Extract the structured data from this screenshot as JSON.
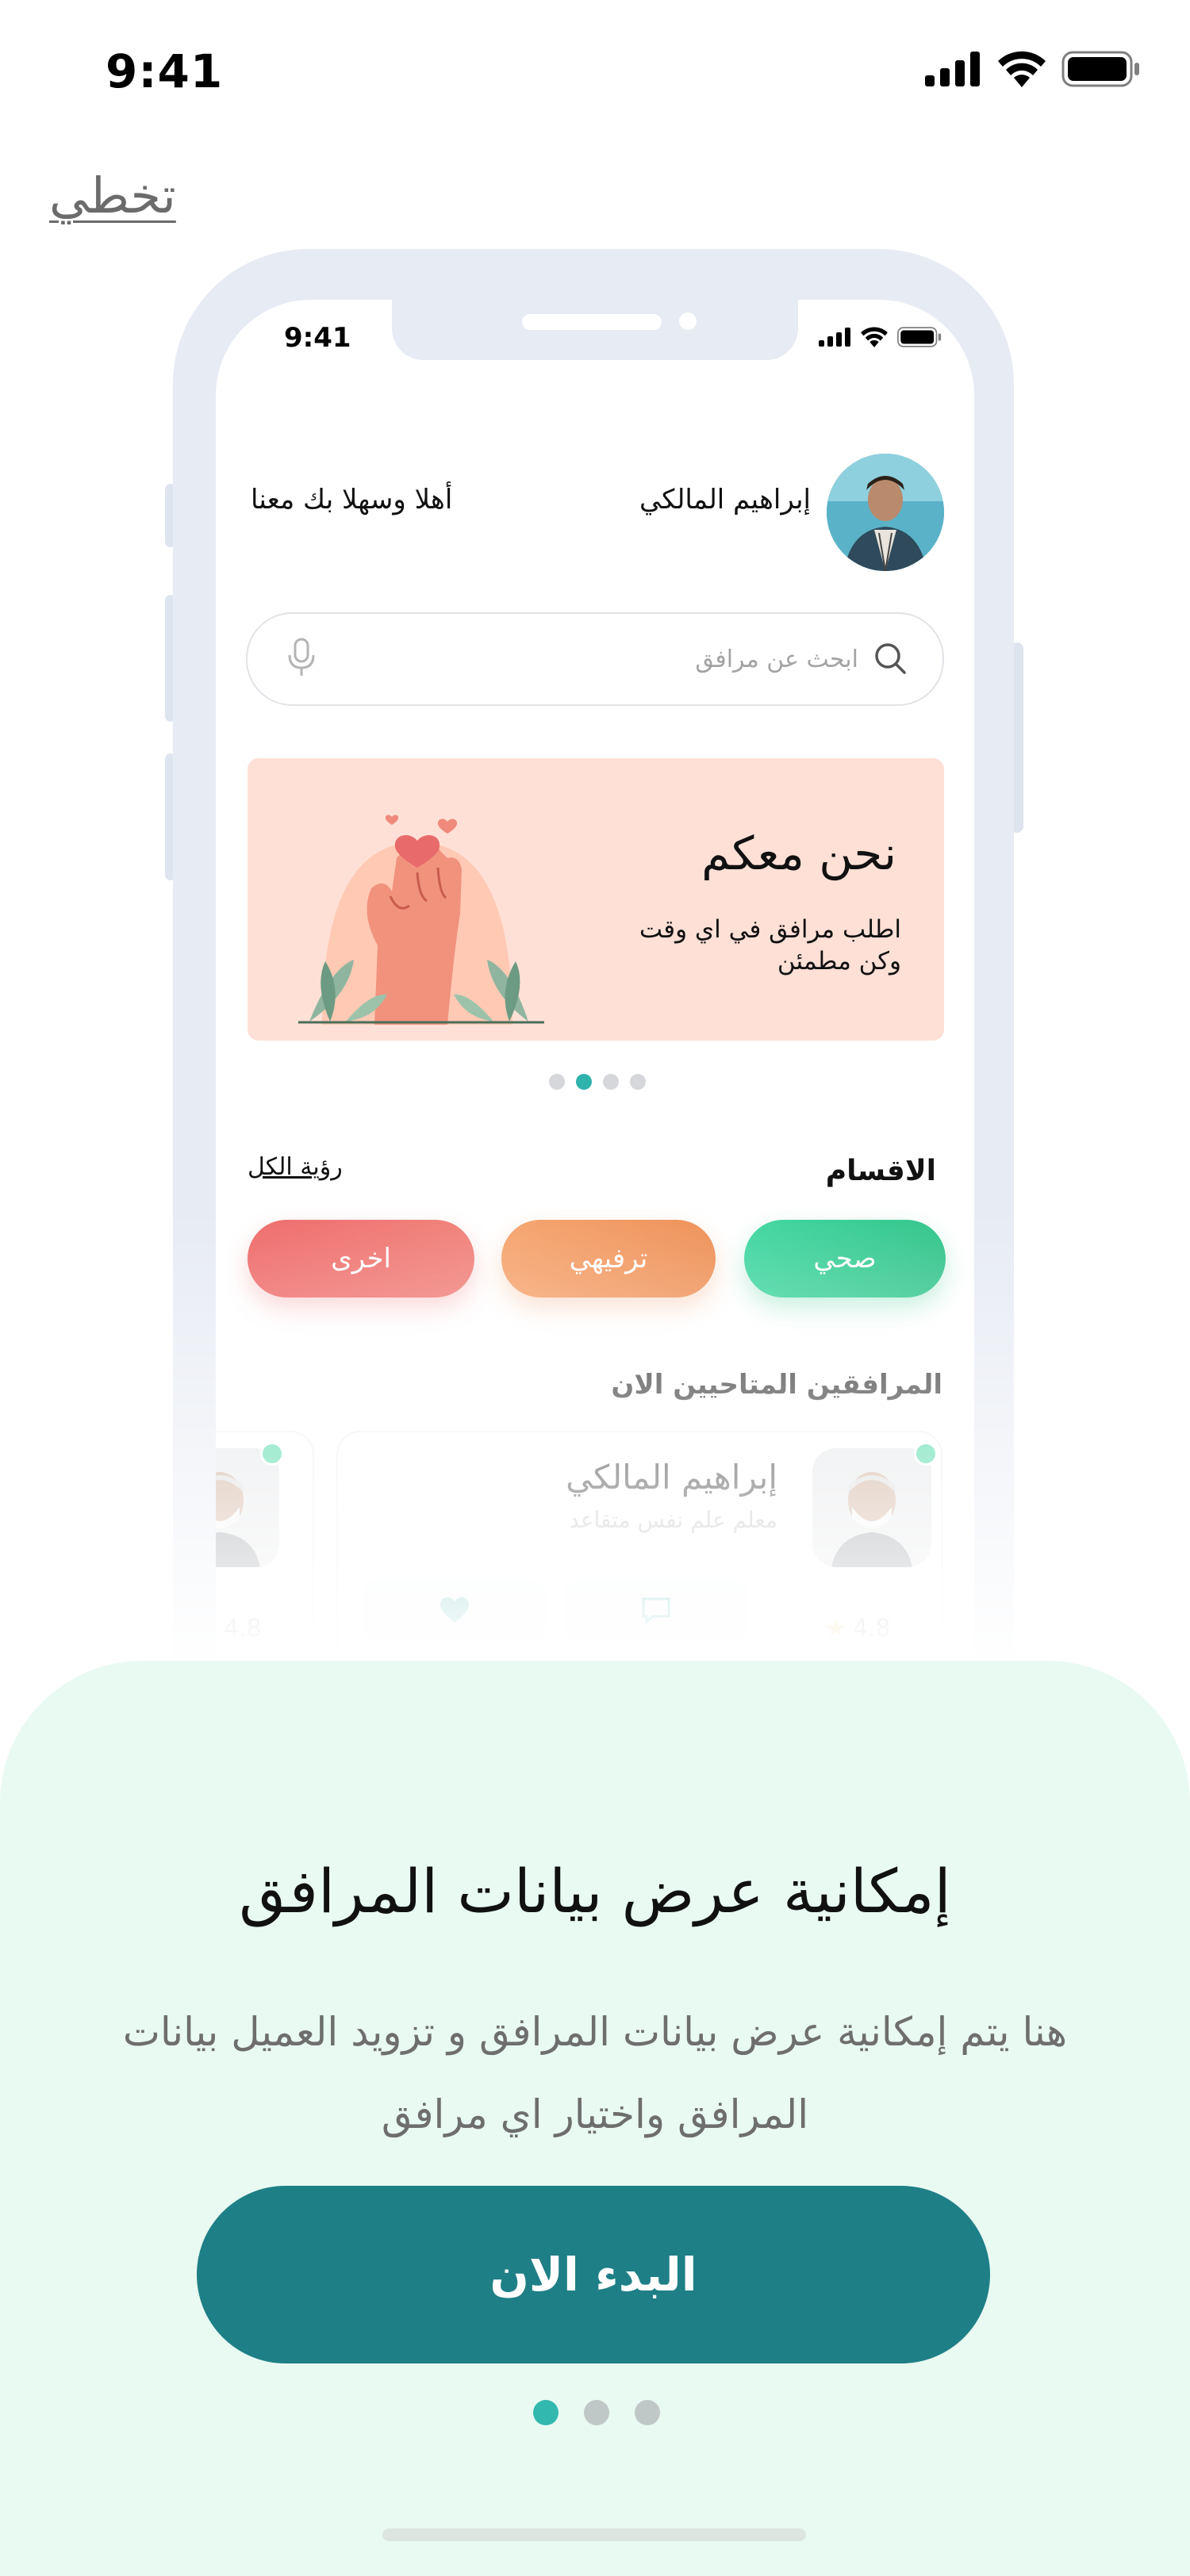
{
  "status_bar": {
    "time": "9:41"
  },
  "skip_label": "تخطي",
  "mockup": {
    "time": "9:41",
    "user_name": "إبراهيم المالكي",
    "welcome": "أهلا وسهلا بك معنا",
    "search": {
      "placeholder": "ابحث عن مرافق"
    },
    "banner": {
      "title": "نحن معكم",
      "subtitle": "اطلب مرافق في اي وقت وكن مطمئن",
      "dots_total": 4,
      "active_dot": 2
    },
    "categories": {
      "title": "الاقسام",
      "see_all": "رؤية الكل",
      "items": [
        {
          "label": "صحي",
          "color": "#30c389"
        },
        {
          "label": "ترفيهي",
          "color": "#ee9056"
        },
        {
          "label": "اخرى",
          "color": "#ee6a6a"
        }
      ]
    },
    "available": {
      "title": "المرافقين المتاحيين الان",
      "companion": {
        "name": "إبراهيم المالكي",
        "role": "معلم علم نفس متقاعد",
        "rating": "4.8"
      },
      "second_rating": "4.8"
    }
  },
  "onboarding": {
    "title": "إمكانية عرض بيانات المرافق",
    "description": "هنا يتم إمكانية عرض بيانات المرافق و تزويد العميل بيانات المرافق واختيار اي مرافق",
    "cta_label": "البدء الان",
    "page_total": 3,
    "page_active": 1,
    "accent_color": "#1f7f86"
  }
}
